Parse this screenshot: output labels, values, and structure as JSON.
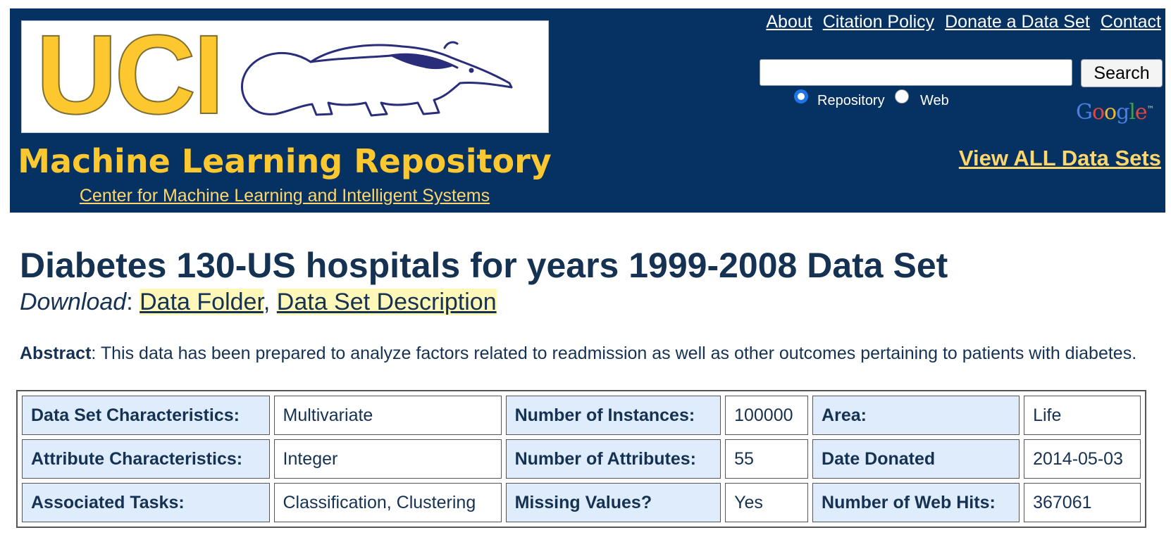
{
  "header": {
    "logo_text": "UCI",
    "title": "Machine Learning Repository",
    "center_link": "Center for Machine Learning and Intelligent Systems",
    "nav": [
      "About",
      "Citation Policy",
      "Donate a Data Set",
      "Contact"
    ],
    "search": {
      "value": "",
      "button_label": "Search"
    },
    "search_scope": {
      "options": [
        "Repository",
        "Web"
      ],
      "selected": "Repository"
    },
    "google_logo": "Google",
    "view_all_label": "View ALL Data Sets"
  },
  "dataset": {
    "title": "Diabetes 130-US hospitals for years 1999-2008 Data Set",
    "download_label": "Download",
    "download_links": [
      "Data Folder",
      "Data Set Description"
    ],
    "abstract_label": "Abstract",
    "abstract_text": ": This data has been prepared to analyze factors related to readmission as well as other outcomes pertaining to patients with diabetes."
  },
  "details_table": [
    [
      "Data Set Characteristics:",
      "Multivariate",
      "Number of Instances:",
      "100000",
      "Area:",
      "Life"
    ],
    [
      "Attribute Characteristics:",
      "Integer",
      "Number of Attributes:",
      "55",
      "Date Donated",
      "2014-05-03"
    ],
    [
      "Associated Tasks:",
      "Classification, Clustering",
      "Missing Values?",
      "Yes",
      "Number of Web Hits:",
      "367061"
    ]
  ],
  "colors": {
    "banner_bg": "#053262",
    "logo_gold": "#fdc82f",
    "link_gold": "#fdd76b",
    "title_navy": "#163253",
    "label_cell_bg": "#deecfc",
    "download_highlight": "#fff8b8"
  }
}
